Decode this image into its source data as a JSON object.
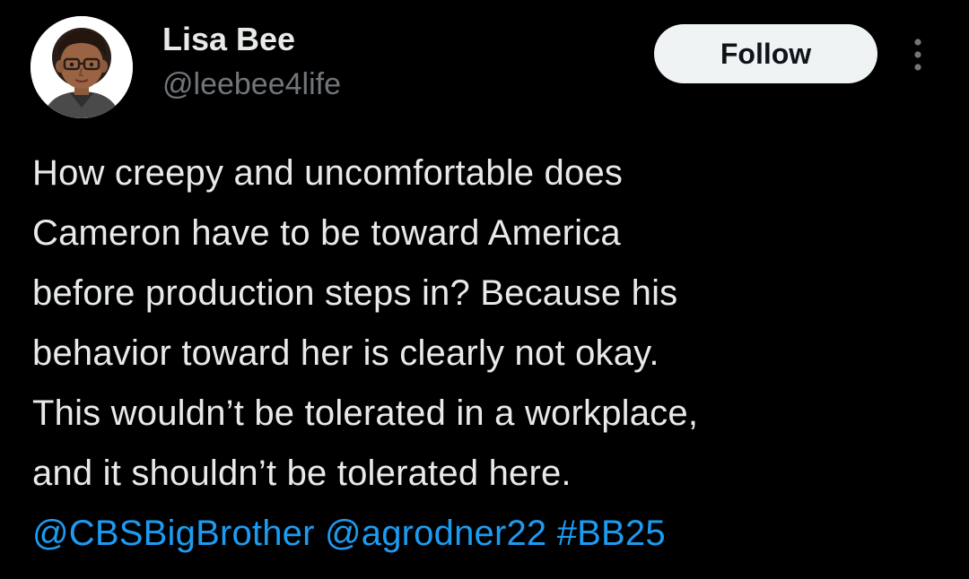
{
  "author": {
    "display_name": "Lisa Bee",
    "handle": "@leebee4life"
  },
  "actions": {
    "follow_label": "Follow",
    "more_icon": "more-vertical-icon"
  },
  "tweet": {
    "lines": [
      "How creepy and uncomfortable does",
      "Cameron have to be toward America",
      "before production steps in? Because his",
      "behavior toward her is clearly not okay.",
      "This wouldn’t be tolerated in a workplace,",
      "and it shouldn’t be tolerated here."
    ],
    "mentions": [
      "@CBSBigBrother",
      "@agrodner22"
    ],
    "hashtag": "#BB25"
  },
  "colors": {
    "background": "#000000",
    "text": "#e7e9ea",
    "secondary_text": "#71767b",
    "link": "#1d9bf0",
    "follow_button_bg": "#eff3f4",
    "follow_button_text": "#0f1419"
  }
}
